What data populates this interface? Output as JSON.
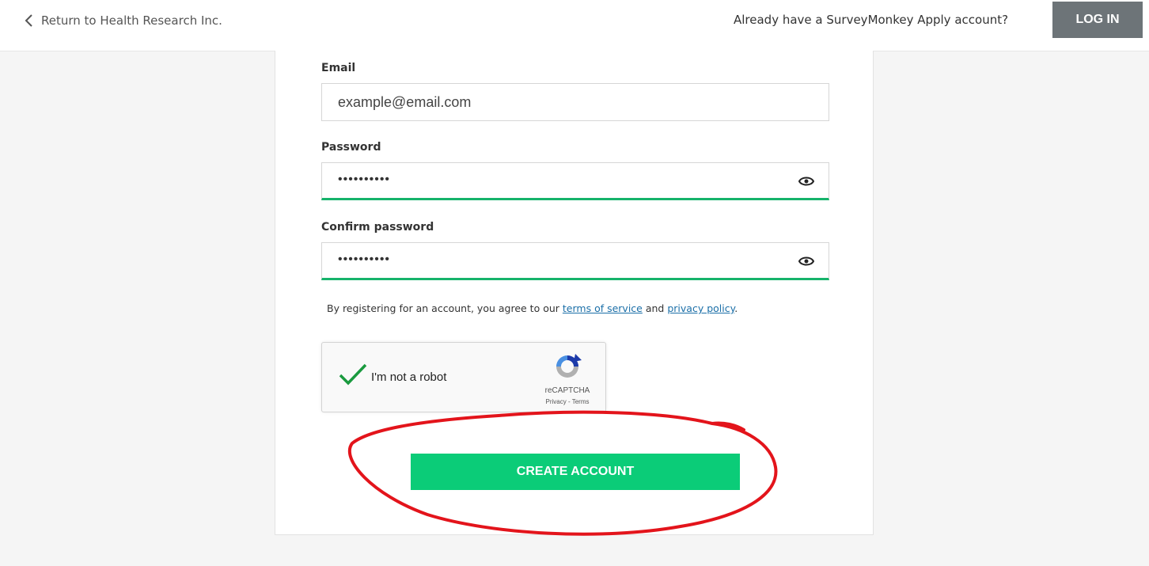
{
  "header": {
    "back_link": "Return to Health Research Inc.",
    "already_text": "Already have a SurveyMonkey Apply account?",
    "login_label": "LOG IN"
  },
  "form": {
    "email": {
      "label": "Email",
      "value": "example@email.com"
    },
    "password": {
      "label": "Password",
      "masked_value": "••••••••••"
    },
    "confirm_password": {
      "label": "Confirm password",
      "masked_value": "••••••••••"
    },
    "terms": {
      "prefix": "By registering for an account, you agree to our ",
      "terms_link": "terms of service",
      "middle": " and ",
      "privacy_link": "privacy policy",
      "suffix": "."
    },
    "captcha": {
      "label": "I'm not a robot",
      "brand": "reCAPTCHA",
      "privacy": "Privacy",
      "separator": " - ",
      "terms": "Terms",
      "checked": true
    },
    "submit_label": "CREATE ACCOUNT"
  },
  "colors": {
    "accent_green": "#0bcc78",
    "strength_bar": "#16b36b",
    "login_button": "#6d7478",
    "annotation_red": "#e3141b"
  }
}
